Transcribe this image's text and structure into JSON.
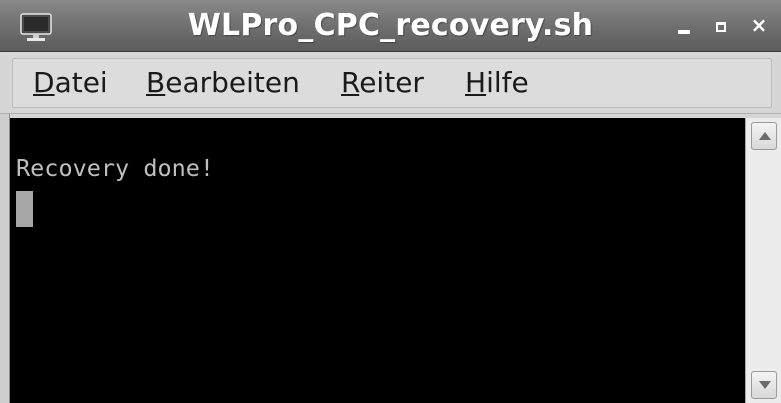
{
  "window": {
    "title": "WLPro_CPC_recovery.sh",
    "icon": "terminal-icon",
    "controls": {
      "minimize": "minimize-icon",
      "maximize": "maximize-icon",
      "close": "close-icon",
      "close_label": "×"
    }
  },
  "menu": {
    "items": [
      {
        "mnemonic": "D",
        "rest": "atei"
      },
      {
        "mnemonic": "B",
        "rest": "earbeiten"
      },
      {
        "mnemonic": "R",
        "rest": "eiter"
      },
      {
        "mnemonic": "H",
        "rest": "ilfe"
      }
    ]
  },
  "terminal": {
    "output": "Recovery done!",
    "background": "#000000",
    "foreground": "#bfbfbf"
  },
  "scrollbar": {
    "up_icon": "arrow-up-icon",
    "down_icon": "arrow-down-icon"
  }
}
